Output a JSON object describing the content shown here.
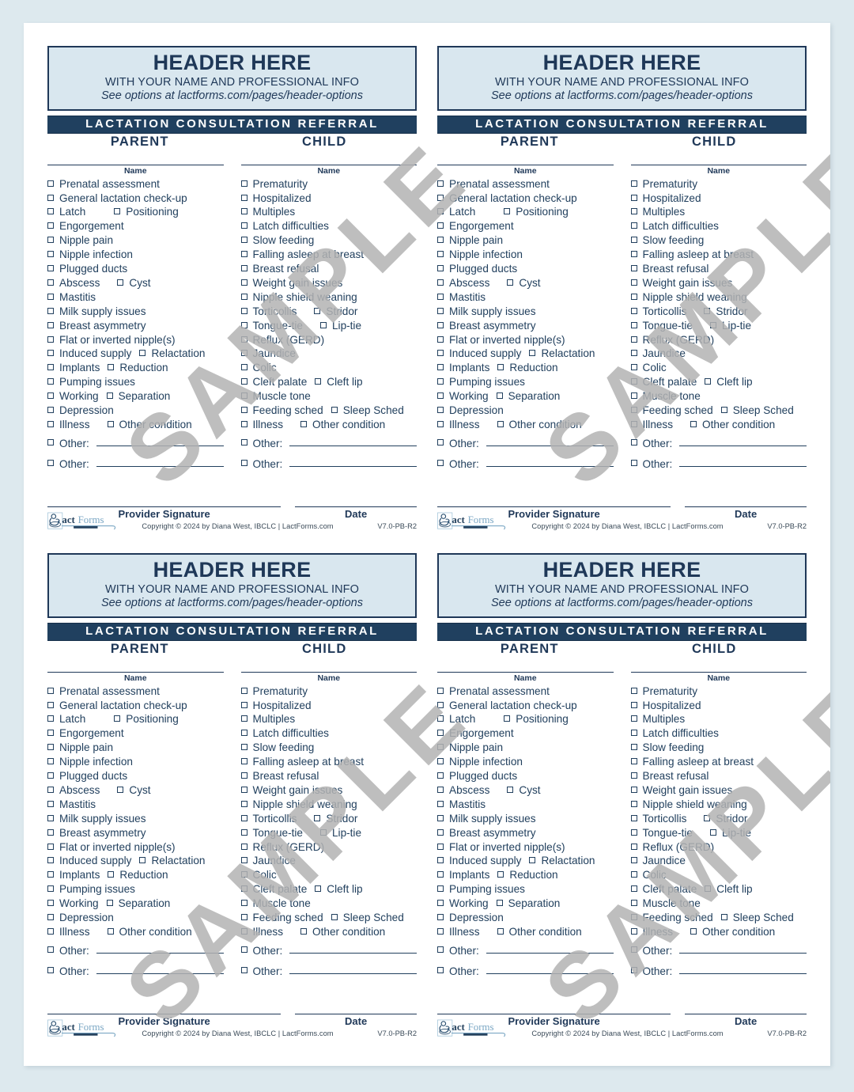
{
  "page": {
    "background_color": "#dde9ee",
    "sheet_color": "#ffffff",
    "layout": "4-up (2x2) identical referral cards"
  },
  "watermark": {
    "text": "SAMPLE",
    "color": "#b3b3b3",
    "count": 4
  },
  "colors": {
    "navy": "#20405f",
    "navy_text": "#1f3858",
    "light_blue": "#d9e7ef",
    "body_text": "#22405e"
  },
  "card": {
    "header": {
      "title": "HEADER HERE",
      "subtitle": "WITH YOUR NAME AND PROFESSIONAL INFO",
      "link_note": "See options at lactforms.com/pages/header-options"
    },
    "band_title": "LACTATION CONSULTATION REFERRAL",
    "column_headings": {
      "parent": "PARENT",
      "child": "CHILD"
    },
    "name_label": "Name",
    "parent_items": [
      {
        "label": "Prenatal assessment"
      },
      {
        "label": "General lactation check-up"
      },
      {
        "label": "Latch",
        "label2": "Positioning",
        "gap": "gap-lg"
      },
      {
        "label": "Engorgement"
      },
      {
        "label": "Nipple pain"
      },
      {
        "label": "Nipple infection"
      },
      {
        "label": "Plugged ducts"
      },
      {
        "label": "Abscess",
        "label2": "Cyst",
        "gap": "gap-md"
      },
      {
        "label": "Mastitis"
      },
      {
        "label": "Milk supply issues"
      },
      {
        "label": "Breast asymmetry"
      },
      {
        "label": "Flat or inverted nipple(s)"
      },
      {
        "label": "Induced supply",
        "label2": "Relactation",
        "gap": "gap-sm"
      },
      {
        "label": "Implants",
        "label2": "Reduction",
        "gap": "gap-sm"
      },
      {
        "label": "Pumping issues"
      },
      {
        "label": "Working",
        "label2": "Separation",
        "gap": "gap-sm"
      },
      {
        "label": "Depression"
      },
      {
        "label": "Illness",
        "label2": "Other condition",
        "gap": "gap-md"
      }
    ],
    "child_items": [
      {
        "label": "Prematurity"
      },
      {
        "label": "Hospitalized"
      },
      {
        "label": "Multiples"
      },
      {
        "label": "Latch difficulties"
      },
      {
        "label": "Slow feeding"
      },
      {
        "label": "Falling asleep at breast"
      },
      {
        "label": "Breast refusal"
      },
      {
        "label": "Weight gain issues"
      },
      {
        "label": "Nipple shield weaning"
      },
      {
        "label": "Torticollis",
        "label2": "Stridor",
        "gap": "gap-md"
      },
      {
        "label": "Tongue-tie",
        "label2": "Lip-tie",
        "gap": "gap-md"
      },
      {
        "label": "Reflux (GERD)"
      },
      {
        "label": "Jaundice"
      },
      {
        "label": "Colic"
      },
      {
        "label": "Cleft palate",
        "label2": "Cleft lip",
        "gap": "gap-sm"
      },
      {
        "label": "Muscle tone"
      },
      {
        "label": "Feeding sched",
        "label2": "Sleep Sched",
        "gap": "gap-sm"
      },
      {
        "label": "Illness",
        "label2": "Other condition",
        "gap": "gap-md"
      }
    ],
    "other_label": "Other:",
    "footer": {
      "provider_signature_label": "Provider Signature",
      "date_label": "Date",
      "logo_text_1": "act",
      "logo_text_2": "Forms",
      "copyright": "Copyright © 2024 by Diana West, IBCLC  |  LactForms.com",
      "version": "V7.0-PB-R2"
    }
  }
}
